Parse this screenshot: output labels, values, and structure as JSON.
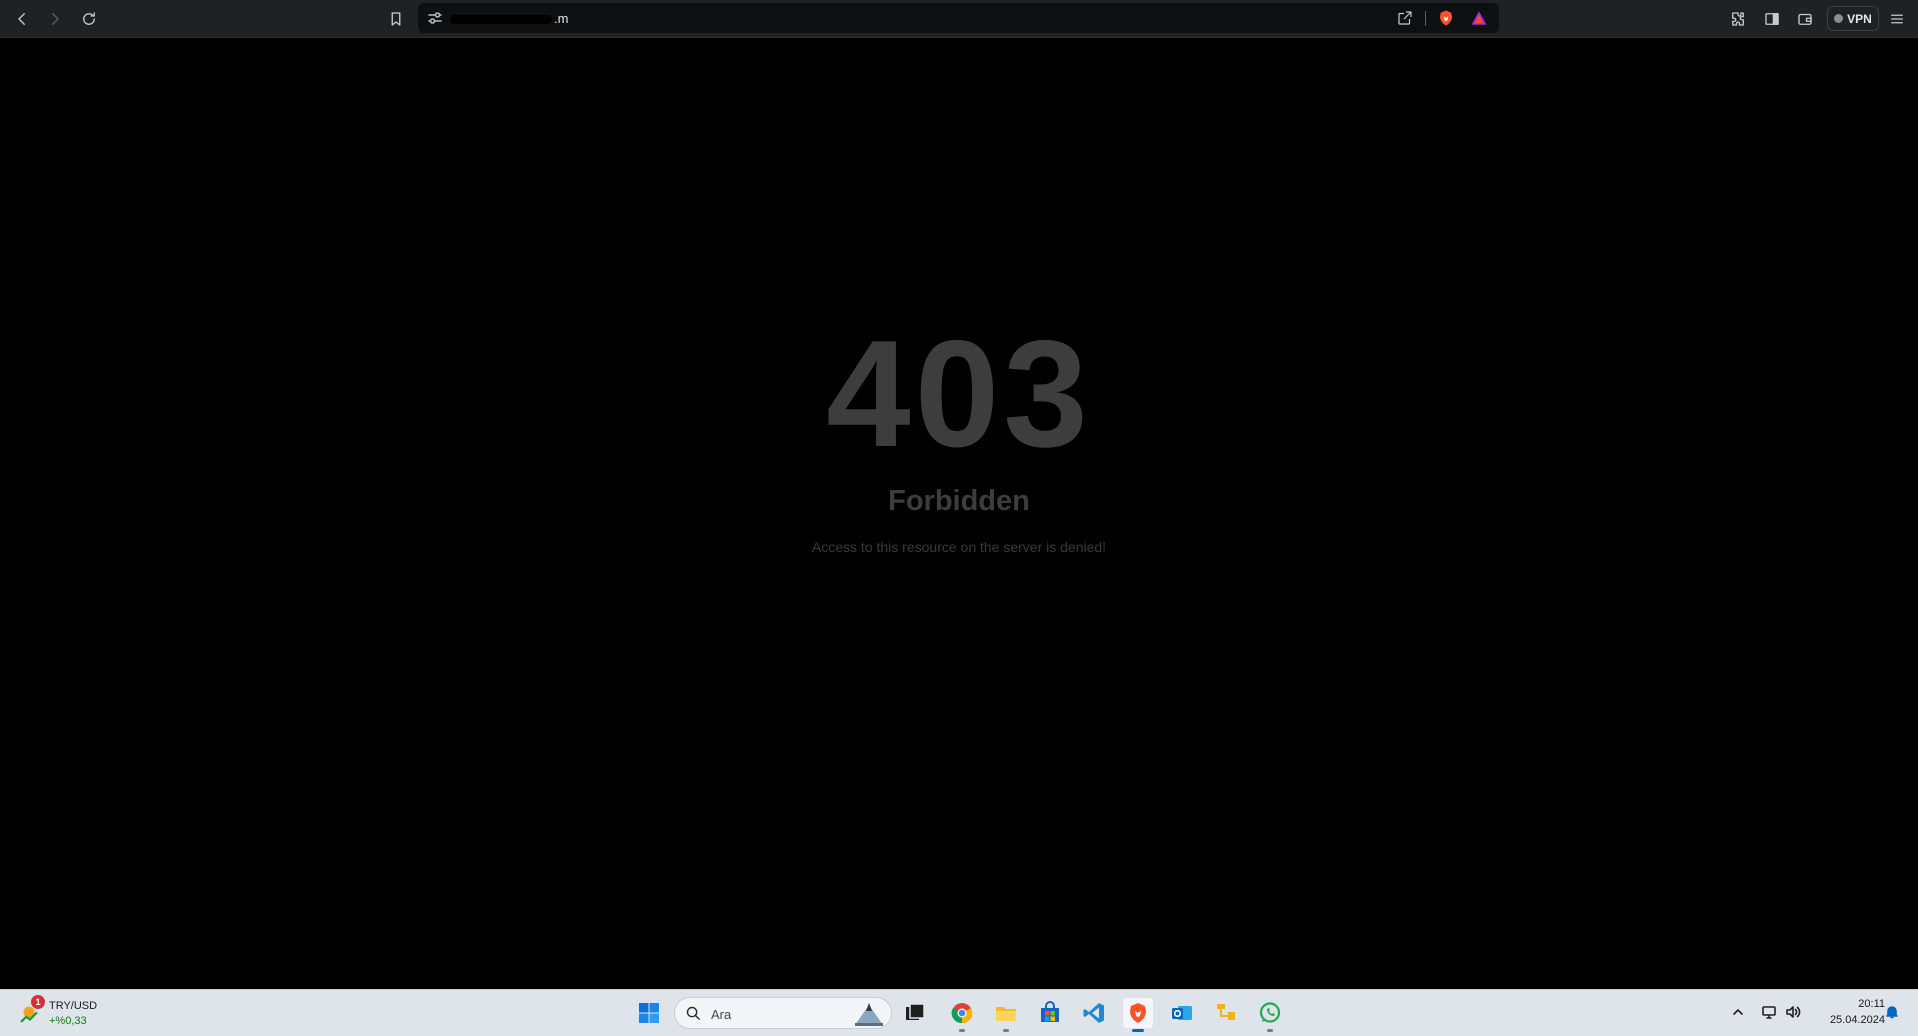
{
  "browser": {
    "url_visible_suffix": ".m",
    "vpn_label": "VPN"
  },
  "page": {
    "code": "403",
    "title": "Forbidden",
    "message": "Access to this resource on the server is denied!"
  },
  "taskbar": {
    "widget": {
      "badge": "1",
      "title": "TRY/USD",
      "change": "+%0,33"
    },
    "search": {
      "placeholder": "Ara"
    },
    "clock": {
      "time": "20:11",
      "date": "25.04.2024"
    }
  },
  "colors": {
    "toolbar_bg": "#1f2124",
    "page_bg": "#000000",
    "error_text": "#3d3d3d",
    "taskbar_bg": "#dfe3ea",
    "accent": "#0067c0"
  }
}
